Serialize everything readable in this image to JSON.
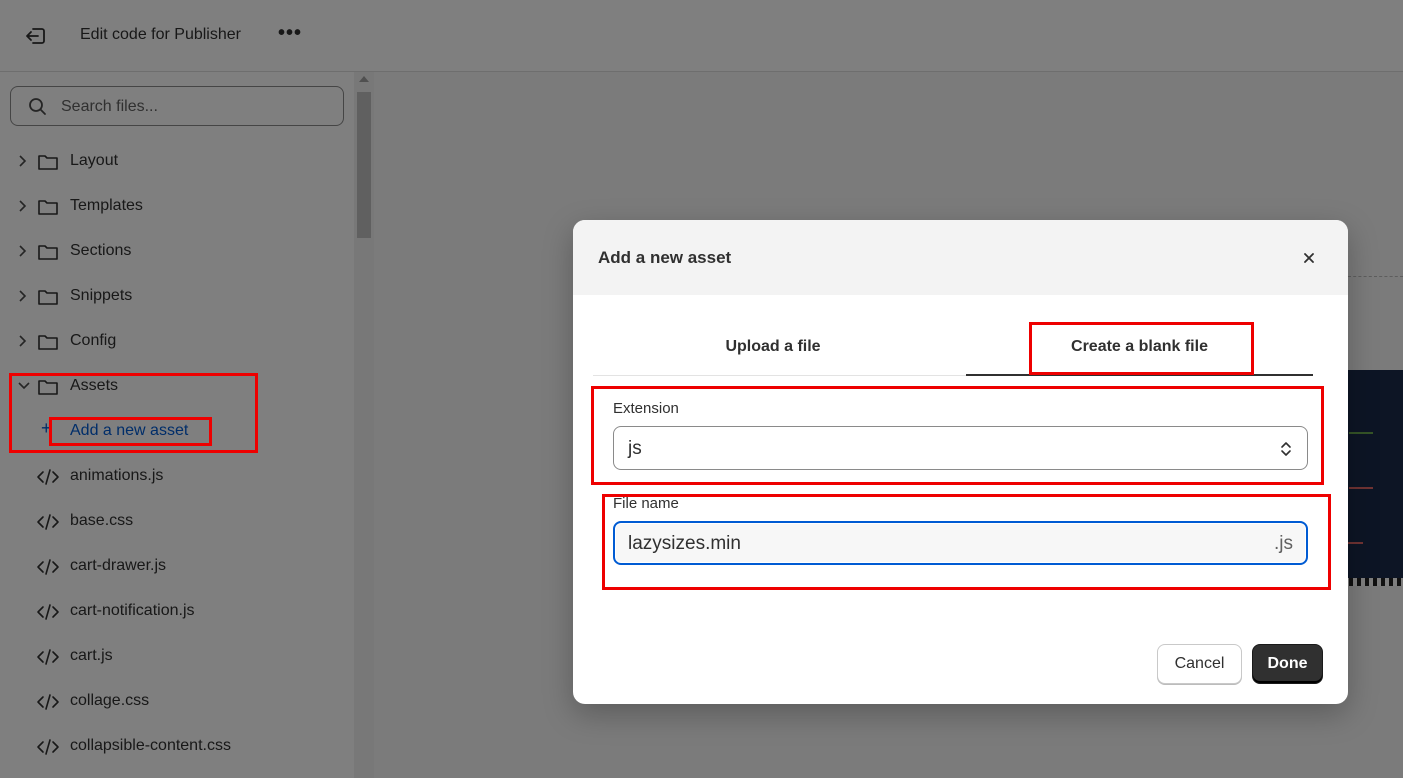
{
  "header": {
    "title": "Edit code for Publisher",
    "more_label": "•••"
  },
  "sidebar": {
    "search_placeholder": "Search files...",
    "folders": [
      {
        "label": "Layout",
        "expanded": false
      },
      {
        "label": "Templates",
        "expanded": false
      },
      {
        "label": "Sections",
        "expanded": false
      },
      {
        "label": "Snippets",
        "expanded": false
      },
      {
        "label": "Config",
        "expanded": false
      },
      {
        "label": "Assets",
        "expanded": true
      }
    ],
    "add_asset": {
      "plus": "+",
      "label": "Add a new asset"
    },
    "files": [
      "animations.js",
      "base.css",
      "cart-drawer.js",
      "cart-notification.js",
      "cart.js",
      "collage.css",
      "collapsible-content.css"
    ]
  },
  "modal": {
    "title": "Add a new asset",
    "tabs": [
      {
        "label": "Upload a file",
        "selected": false
      },
      {
        "label": "Create a blank file",
        "selected": true
      }
    ],
    "extension": {
      "label": "Extension",
      "value": "js"
    },
    "file_name": {
      "label": "File name",
      "value": "lazysizes.min",
      "suffix": ".js"
    },
    "cancel_label": "Cancel",
    "done_label": "Done"
  },
  "colors": {
    "annotation": "#ee0000",
    "link": "#005bd3",
    "primary_button": "#303030",
    "focus_ring": "#005bd3"
  }
}
